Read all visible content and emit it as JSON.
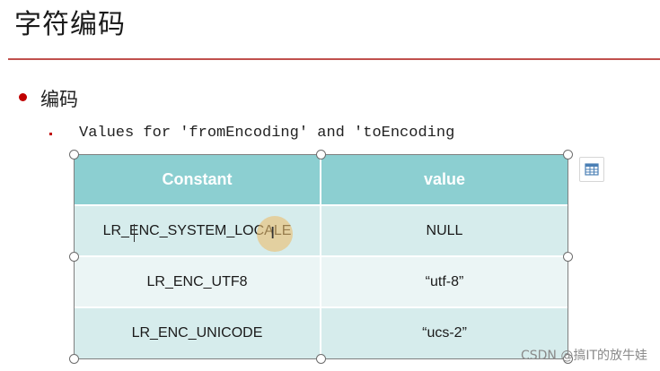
{
  "slide": {
    "title": "字符编码",
    "bullet1": "编码",
    "bullet2": "Values for 'fromEncoding' and 'toEncoding"
  },
  "table": {
    "headers": [
      "Constant",
      "value"
    ],
    "rows": [
      [
        "LR_ENC_SYSTEM_LOCALE",
        "NULL"
      ],
      [
        "LR_ENC_UTF8",
        "“utf-8”"
      ],
      [
        "LR_ENC_UNICODE",
        "“ucs-2”"
      ]
    ]
  },
  "cursor": {
    "ibeam_glyph": "I"
  },
  "watermark": "CSDN @搞IT的放牛娃",
  "colors": {
    "accent_red": "#c00000",
    "title_rule": "#c0504d",
    "header_teal": "#8ccfd1",
    "row_odd": "#d6ecec",
    "row_even": "#ebf5f5"
  },
  "icons": {
    "bullet1": "red-dot-bullet",
    "bullet2": "small-square-bullet",
    "layout_button": "table-layout-icon"
  }
}
